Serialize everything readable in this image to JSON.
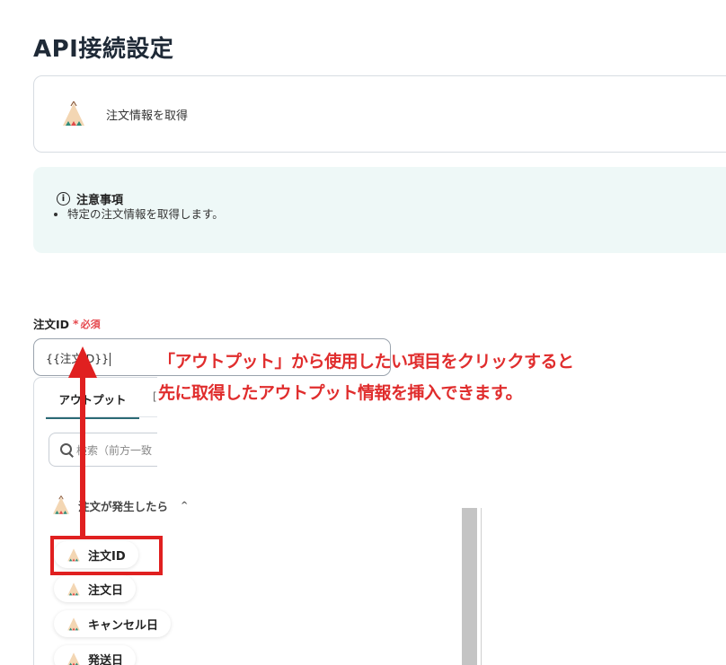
{
  "page": {
    "title": "API接続設定"
  },
  "app_card": {
    "action_label": "注文情報を取得",
    "icon": "tipi-tent-icon"
  },
  "notice": {
    "heading": "注意事項",
    "icon": "info-circle-icon",
    "items": [
      "特定の注文情報を取得します。"
    ]
  },
  "order_field": {
    "label": "注文ID",
    "required_mark": "*",
    "required_text": "必須",
    "value": "{{注文ID}}"
  },
  "dropdown": {
    "tab_active": "アウトプット",
    "tab_next_partial": "[",
    "search_placeholder": "検索（前方一致",
    "group_label": "注文が発生したら",
    "group_chevron": "^",
    "items": [
      "注文ID",
      "注文日",
      "キャンセル日",
      "発送日"
    ]
  },
  "annotation": {
    "line1": "「アウトプット」から使用したい項目をクリックすると",
    "line2": "先に取得したアウトプット情報を挿入できます。",
    "color": "#e02d2d"
  },
  "colors": {
    "accent_teal": "#2b6a75",
    "notice_bg": "#eef8f7",
    "required_red": "#e5484d"
  }
}
